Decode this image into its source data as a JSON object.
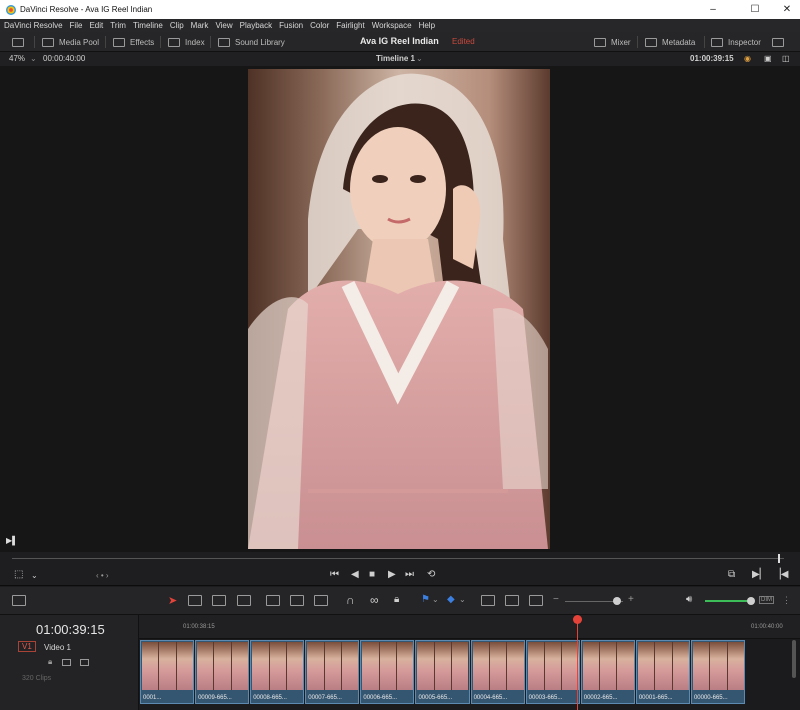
{
  "window": {
    "title": "DaVinci Resolve - Ava IG Reel Indian",
    "controls": [
      "–",
      "☐",
      "✕"
    ]
  },
  "menu": [
    "DaVinci Resolve",
    "File",
    "Edit",
    "Trim",
    "Timeline",
    "Clip",
    "Mark",
    "View",
    "Playback",
    "Fusion",
    "Color",
    "Fairlight",
    "Workspace",
    "Help"
  ],
  "toolbar": {
    "media_pool": "Media Pool",
    "effects": "Effects",
    "index": "Index",
    "sound_library": "Sound Library",
    "project_title": "Ava IG Reel Indian",
    "status": "Edited",
    "mixer": "Mixer",
    "metadata": "Metadata",
    "inspector": "Inspector"
  },
  "viewer": {
    "zoom": "47%",
    "duration": "00:00:40:00",
    "timeline_name": "Timeline 1",
    "timecode": "01:00:39:15"
  },
  "timeline": {
    "timecode": "01:00:39:15",
    "track_id": "V1",
    "track_name": "Video 1",
    "clip_count": "320 Clips",
    "ruler_start": "01:00:38:15",
    "ruler_end": "01:00:40:00",
    "clips": [
      "0001...",
      "00009-665...",
      "00008-665...",
      "00007-665...",
      "00006-665...",
      "00005-665...",
      "00004-665...",
      "00003-665...",
      "00002-665...",
      "00001-665...",
      "00000-665..."
    ]
  },
  "colors": {
    "accent_red": "#e5433a",
    "clip_blue": "#355671",
    "volume_green": "#3dbd57"
  }
}
